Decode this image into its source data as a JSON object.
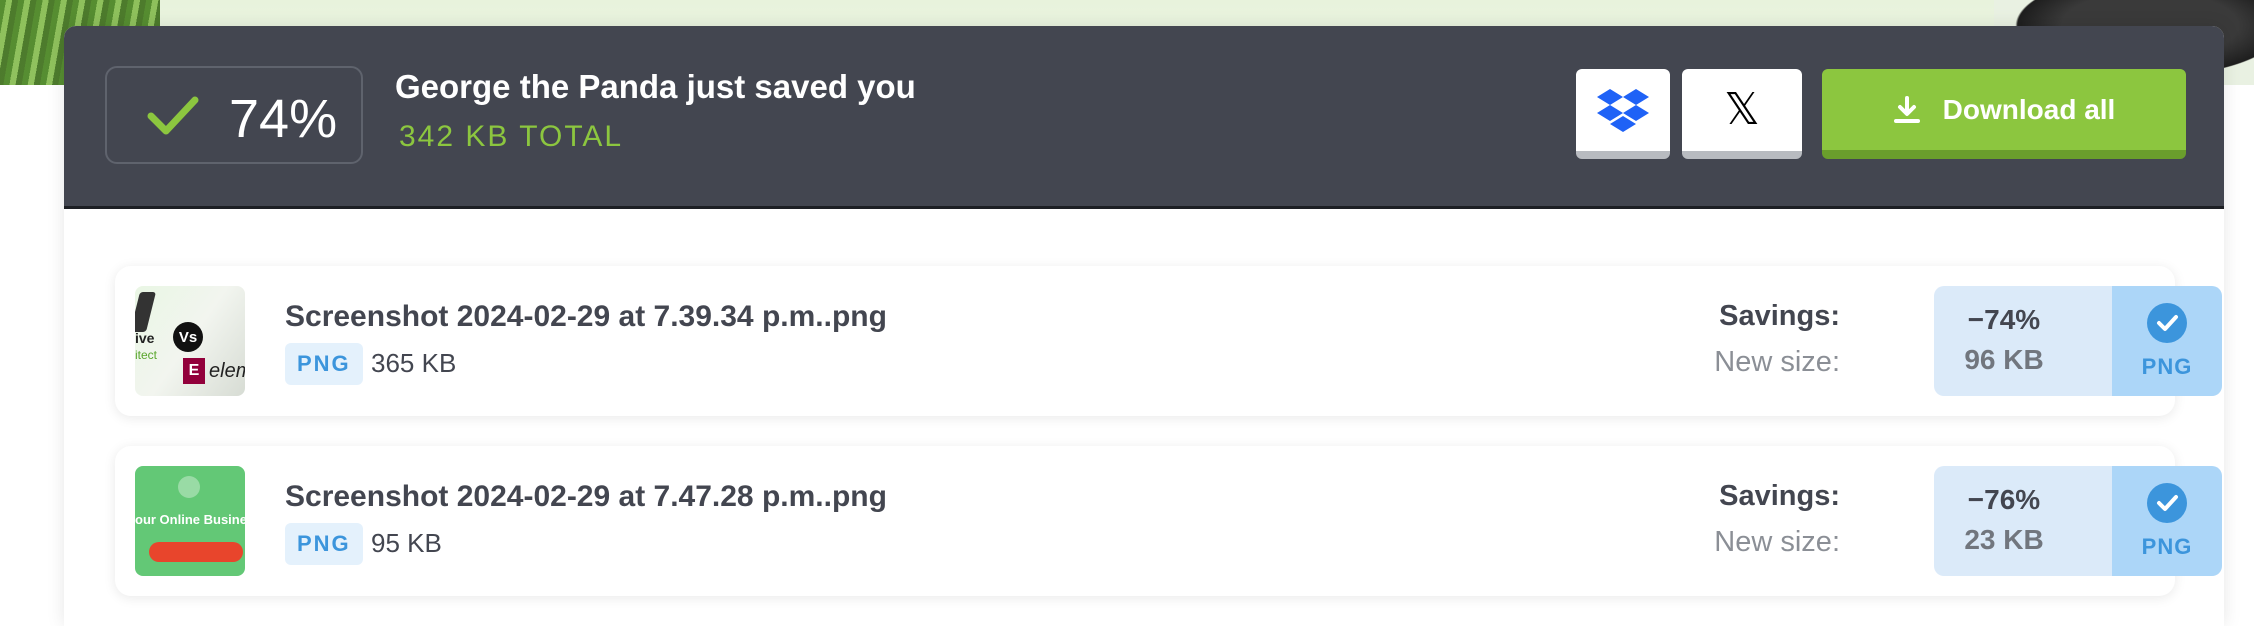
{
  "summary": {
    "percent_saved": "74%",
    "title": "George the Panda just saved you",
    "total": "342 KB TOTAL"
  },
  "actions": {
    "dropbox_icon": "dropbox-icon",
    "x_icon": "x-logo-icon",
    "x_glyph": "𝕏",
    "download_label": "Download all"
  },
  "files": [
    {
      "name": "Screenshot 2024-02-29 at 7.39.34 p.m..png",
      "type": "PNG",
      "original_size": "365 KB",
      "savings_label": "Savings:",
      "new_size_label": "New size:",
      "savings": "−74%",
      "new_size": "96 KB",
      "output_format": "PNG"
    },
    {
      "name": "Screenshot 2024-02-29 at 7.47.28 p.m..png",
      "type": "PNG",
      "original_size": "95 KB",
      "savings_label": "Savings:",
      "new_size_label": "New size:",
      "savings": "−76%",
      "new_size": "23 KB",
      "output_format": "PNG"
    }
  ],
  "thumbnails": {
    "thumb1": {
      "text_a": "ive",
      "text_b": "itect",
      "vs": "Vs",
      "logo_letter": "E",
      "logo_text": "elem"
    },
    "thumb2": {
      "text": "our Online Busines"
    }
  },
  "colors": {
    "header_bg": "#434650",
    "accent_green": "#8cc63f",
    "accent_blue": "#3c95dc",
    "result_bg": "#dbeaf9",
    "format_bg": "#acd6f8"
  }
}
